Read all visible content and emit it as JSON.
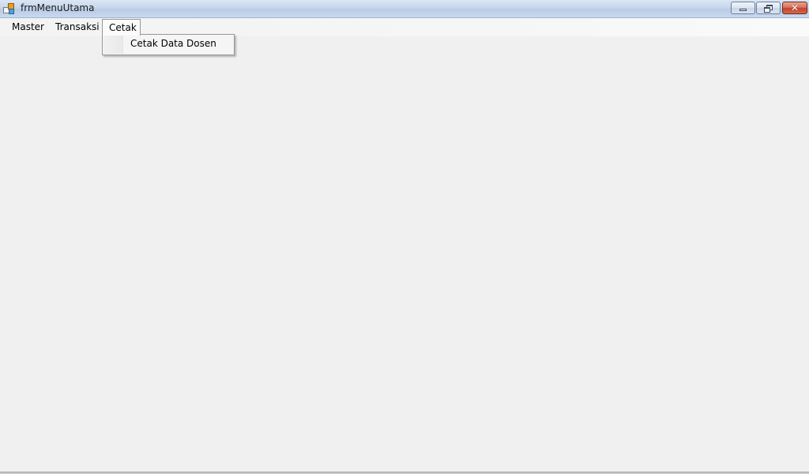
{
  "window": {
    "title": "frmMenuUtama",
    "controls": {
      "minimize_icon": "minimize-icon",
      "restore_icon": "restore-icon",
      "close_icon": "close-icon",
      "close_glyph": "✕"
    }
  },
  "menubar": {
    "items": [
      {
        "label": "Master"
      },
      {
        "label": "Transaksi"
      },
      {
        "label": "Cetak",
        "open": true
      }
    ]
  },
  "dropdown": {
    "parent": "Cetak",
    "items": [
      {
        "label": "Cetak Data Dosen"
      }
    ]
  },
  "colors": {
    "titlebar": "#c6d6ec",
    "client_background": "#f0f0f0",
    "close_button": "#c5422b"
  }
}
